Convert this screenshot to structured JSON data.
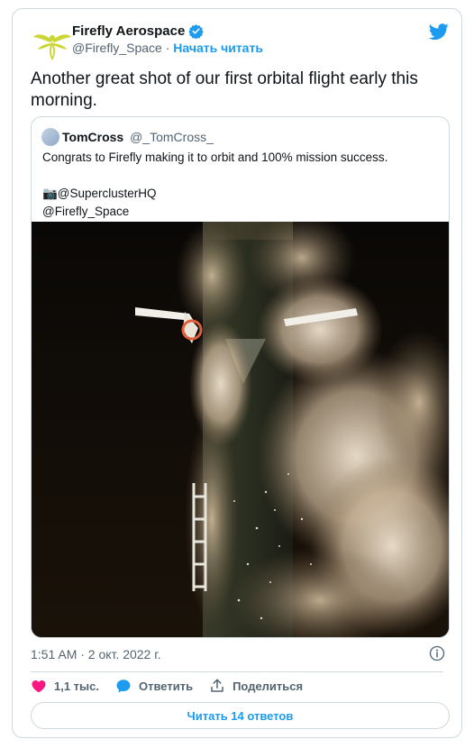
{
  "author": {
    "name": "Firefly Aerospace",
    "handle": "@Firefly_Space",
    "separator": "·",
    "follow_label": "Начать читать"
  },
  "tweet": {
    "text": "Another great shot of our first orbital flight early this morning.",
    "timestamp": "1:51 AM · 2 окт. 2022 г."
  },
  "quoted": {
    "name": "TomCross",
    "handle": "@_TomCross_",
    "text": "Congrats to Firefly making it to orbit and 100% mission success.\n\n📷@SuperclusterHQ\n@Firefly_Space"
  },
  "actions": {
    "likes": "1,1 тыс.",
    "reply_label": "Ответить",
    "share_label": "Поделиться"
  },
  "replies_button": "Читать 14 ответов",
  "icons": {
    "verified": "verified-badge-icon",
    "brand": "twitter-bird-icon",
    "info": "info-icon",
    "like": "heart-icon",
    "reply": "speech-bubble-icon",
    "share": "share-upload-icon"
  },
  "colors": {
    "accent": "#1d9bf0",
    "like": "#f91880",
    "logo": "#cbd634"
  }
}
